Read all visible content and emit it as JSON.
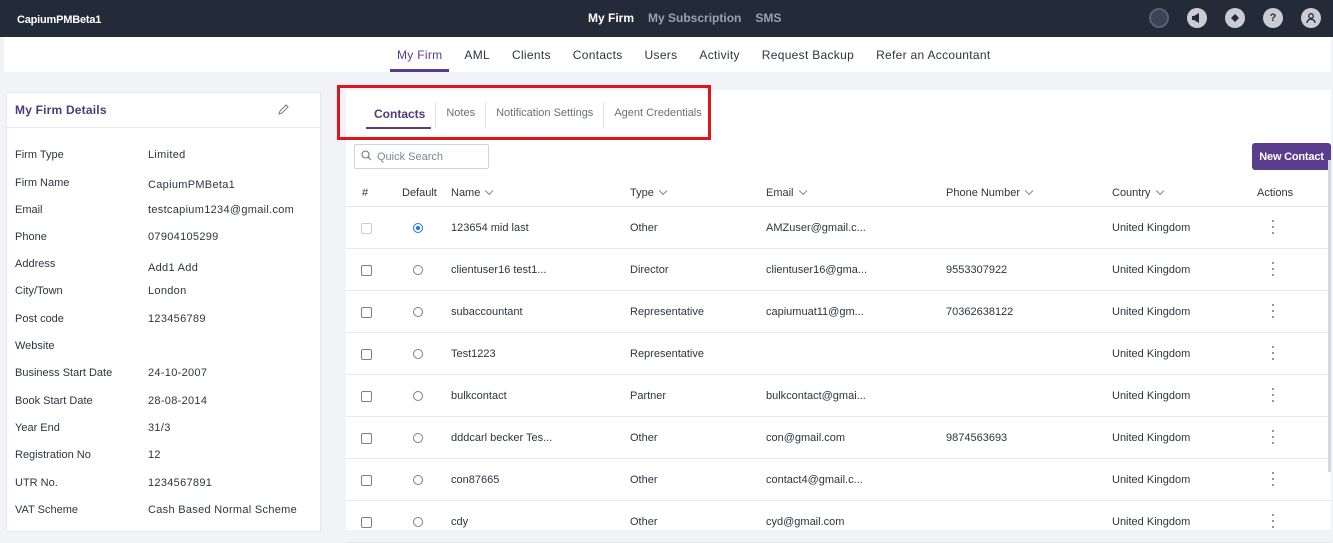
{
  "app": {
    "brand": "CapiumPMBeta1"
  },
  "topnav": [
    {
      "label": "My Firm",
      "active": true
    },
    {
      "label": "My Subscription",
      "active": false
    },
    {
      "label": "SMS",
      "active": false
    }
  ],
  "topicons": [
    "status-icon",
    "megaphone-icon",
    "ticket-icon",
    "help-icon",
    "user-icon"
  ],
  "subnav": [
    {
      "label": "My Firm",
      "active": true
    },
    {
      "label": "AML"
    },
    {
      "label": "Clients"
    },
    {
      "label": "Contacts"
    },
    {
      "label": "Users"
    },
    {
      "label": "Activity"
    },
    {
      "label": "Request Backup"
    },
    {
      "label": "Refer an Accountant"
    }
  ],
  "firm_details": {
    "title": "My Firm Details",
    "rows": [
      {
        "label": "Firm Type",
        "value": "Limited"
      },
      {
        "label": "Firm Name",
        "value": "CapiumPMBeta1"
      },
      {
        "label": "Email",
        "value": "testcapium1234@gmail.com"
      },
      {
        "label": "Phone",
        "value": "07904105299"
      },
      {
        "label": "Address",
        "value": "Add1 Add"
      },
      {
        "label": "City/Town",
        "value": "London"
      },
      {
        "label": "Post code",
        "value": "123456789"
      },
      {
        "label": "Website",
        "value": ""
      },
      {
        "label": "Business Start Date",
        "value": "24-10-2007"
      },
      {
        "label": "Book Start Date",
        "value": "28-08-2014"
      },
      {
        "label": "Year End",
        "value": "31/3"
      },
      {
        "label": "Registration No",
        "value": "12"
      },
      {
        "label": "UTR No.",
        "value": "1234567891"
      },
      {
        "label": "VAT Scheme",
        "value": "Cash Based Normal Scheme"
      }
    ]
  },
  "tabs": [
    {
      "label": "Contacts",
      "active": true
    },
    {
      "label": "Notes"
    },
    {
      "label": "Notification Settings"
    },
    {
      "label": "Agent Credentials"
    }
  ],
  "search": {
    "placeholder": "Quick Search"
  },
  "new_contact_label": "New Contact",
  "table": {
    "headers": {
      "num": "#",
      "default": "Default",
      "name": "Name",
      "type": "Type",
      "email": "Email",
      "phone": "Phone Number",
      "country": "Country",
      "actions": "Actions"
    },
    "rows": [
      {
        "name": "123654 mid last",
        "type": "Other",
        "email": "AMZuser@gmail.c...",
        "phone": "",
        "country": "United Kingdom",
        "default": true,
        "checkbox_disabled": true
      },
      {
        "name": "clientuser16 test1...",
        "type": "Director",
        "email": "clientuser16@gma...",
        "phone": "9553307922",
        "country": "United Kingdom",
        "default": false
      },
      {
        "name": "subaccountant",
        "type": "Representative",
        "email": "capiumuat11@gm...",
        "phone": "70362638122",
        "country": "United Kingdom",
        "default": false
      },
      {
        "name": "Test1223",
        "type": "Representative",
        "email": "",
        "phone": "",
        "country": "United Kingdom",
        "default": false
      },
      {
        "name": "bulkcontact",
        "type": "Partner",
        "email": "bulkcontact@gmai...",
        "phone": "",
        "country": "United Kingdom",
        "default": false
      },
      {
        "name": "dddcarl becker Tes...",
        "type": "Other",
        "email": "con@gmail.com",
        "phone": "9874563693",
        "country": "United Kingdom",
        "default": false
      },
      {
        "name": "con87665",
        "type": "Other",
        "email": "contact4@gmail.c...",
        "phone": "",
        "country": "United Kingdom",
        "default": false
      },
      {
        "name": "cdy",
        "type": "Other",
        "email": "cyd@gmail.com",
        "phone": "",
        "country": "United Kingdom",
        "default": false
      }
    ]
  },
  "colors": {
    "accent": "#5b3b8c",
    "topbar": "#232b38",
    "highlight": "#e0141d"
  }
}
